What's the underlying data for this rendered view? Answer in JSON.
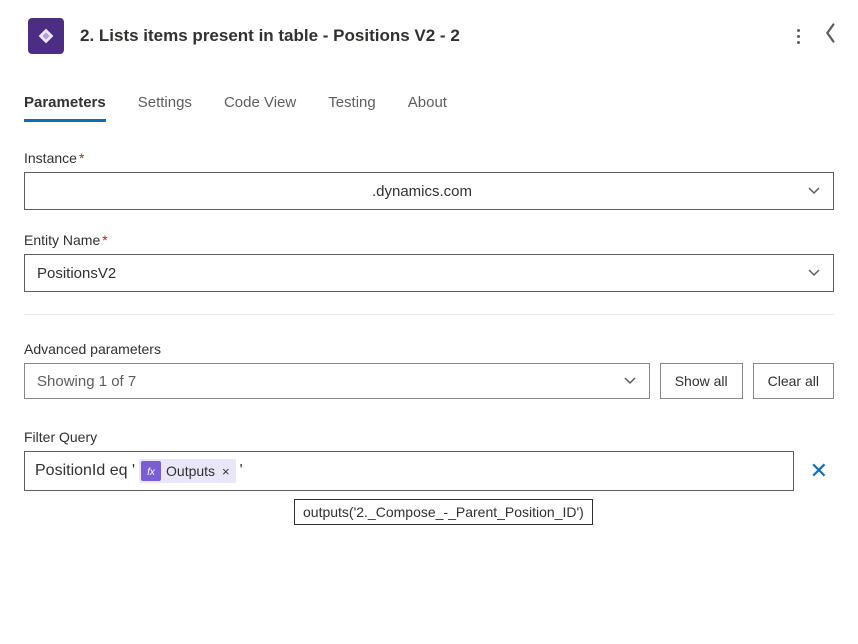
{
  "header": {
    "title": "2. Lists items present in table - Positions V2 - 2"
  },
  "tabs": [
    {
      "label": "Parameters",
      "active": true
    },
    {
      "label": "Settings",
      "active": false
    },
    {
      "label": "Code View",
      "active": false
    },
    {
      "label": "Testing",
      "active": false
    },
    {
      "label": "About",
      "active": false
    }
  ],
  "fields": {
    "instance": {
      "label": "Instance",
      "required": true,
      "value": ".dynamics.com"
    },
    "entity": {
      "label": "Entity Name",
      "required": true,
      "value": "PositionsV2"
    }
  },
  "advanced": {
    "label": "Advanced parameters",
    "summary": "Showing 1 of 7",
    "show_all": "Show all",
    "clear_all": "Clear all"
  },
  "filter": {
    "label": "Filter Query",
    "prefix": "PositionId eq '",
    "token": "Outputs",
    "suffix": "'",
    "tooltip": "outputs('2._Compose_-_Parent_Position_ID')"
  }
}
